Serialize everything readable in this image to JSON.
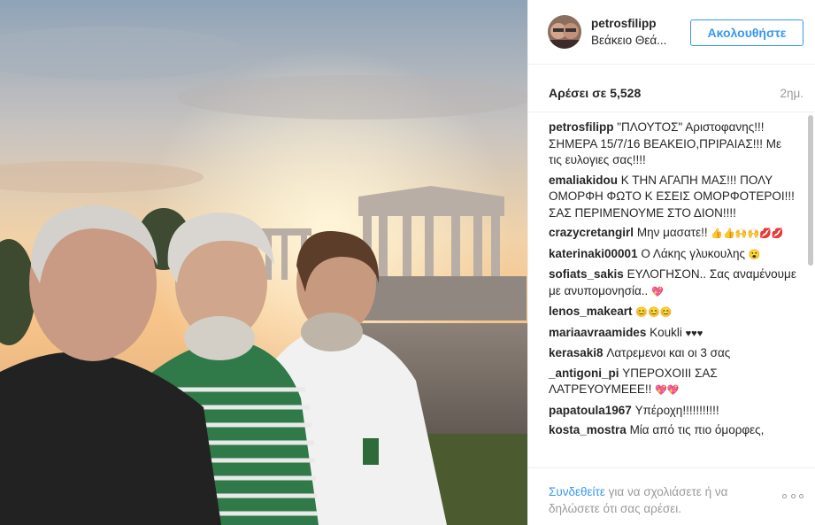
{
  "post": {
    "username": "petrosfilipp",
    "location": "Βεάκειο Θεά...",
    "follow_label": "Ακολουθήστε",
    "likes_label": "Αρέσει σε 5,528",
    "time_ago": "2ημ.",
    "colors": {
      "accent": "#3897f0",
      "muted": "#999999",
      "text": "#262626"
    }
  },
  "comments": [
    {
      "author": "petrosfilipp",
      "text": "\"ΠΛΟΥΤΟΣ\" Αριστοφανης!!! ΣΗΜΕΡΑ 15/7/16 ΒΕΑΚΕΙΟ,ΠΡΙΡΑΙΑΣ!!! Με τις ευλογιες σας!!!!"
    },
    {
      "author": "emaliakidou",
      "text": "Κ ΤΗΝ ΑΓΑΠΗ ΜΑΣ!!! ΠΟΛΥ ΟΜΟΡΦΗ ΦΩΤΟ Κ ΕΣΕΙΣ ΟΜΟΡΦΟΤΕΡΟΙ!!!ΣΑΣ ΠΕΡΙΜΕΝΟΥΜΕ ΣΤΟ ΔΙΟΝ!!!!"
    },
    {
      "author": "crazycretangirl",
      "text": "Μην μασατε!!",
      "emoji": "👍👍🙌🙌💋💋"
    },
    {
      "author": "katerinaki00001",
      "text": "Ο Λάκης γλυκουλης",
      "emoji": "😮"
    },
    {
      "author": "sofiats_sakis",
      "text": "ΕΥΛΟΓΗΣΟΝ.. Σας αναμένουμε με ανυπομονησία..",
      "emoji": "💖"
    },
    {
      "author": "lenos_makeart",
      "text": "",
      "emoji": "😊😊😊"
    },
    {
      "author": "mariaavraamides",
      "text": "Koukli",
      "emoji": "♥♥♥"
    },
    {
      "author": "kerasaki8",
      "text": "Λατρεμενοι και οι 3 σας"
    },
    {
      "author": "_antigoni_pi",
      "text": "ΥΠΕΡΟΧΟΙΙΙ ΣΑΣ ΛΑΤΡΕΥΟΥΜΕΕΕ!!",
      "emoji": "💖💖"
    },
    {
      "author": "papatoula1967",
      "text": "Υπέροχη!!!!!!!!!!!"
    },
    {
      "author": "kosta_mostra",
      "text": "Μία από τις πιο όμορφες,"
    }
  ],
  "footer": {
    "login_link": "Συνδεθείτε",
    "login_rest": " για να σχολιάσετε ή να δηλώσετε ότι σας αρέσει."
  },
  "icons": {
    "more": "more-options-icon"
  }
}
